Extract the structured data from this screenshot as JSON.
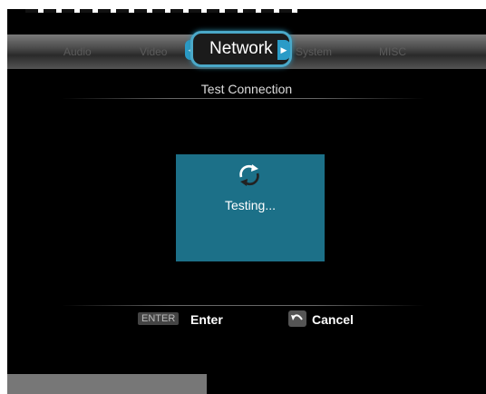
{
  "tabs": [
    {
      "label": "Audio"
    },
    {
      "label": "Video"
    },
    {
      "label": "Network",
      "active": true
    },
    {
      "label": "System"
    },
    {
      "label": "MISC"
    }
  ],
  "section_title": "Test Connection",
  "dialog": {
    "status_text": "Testing..."
  },
  "footer": {
    "enter_key": "ENTER",
    "enter_label": "Enter",
    "cancel_label": "Cancel"
  },
  "colors": {
    "accent": "#4aa8c8",
    "dialog_bg": "#1c7088"
  }
}
